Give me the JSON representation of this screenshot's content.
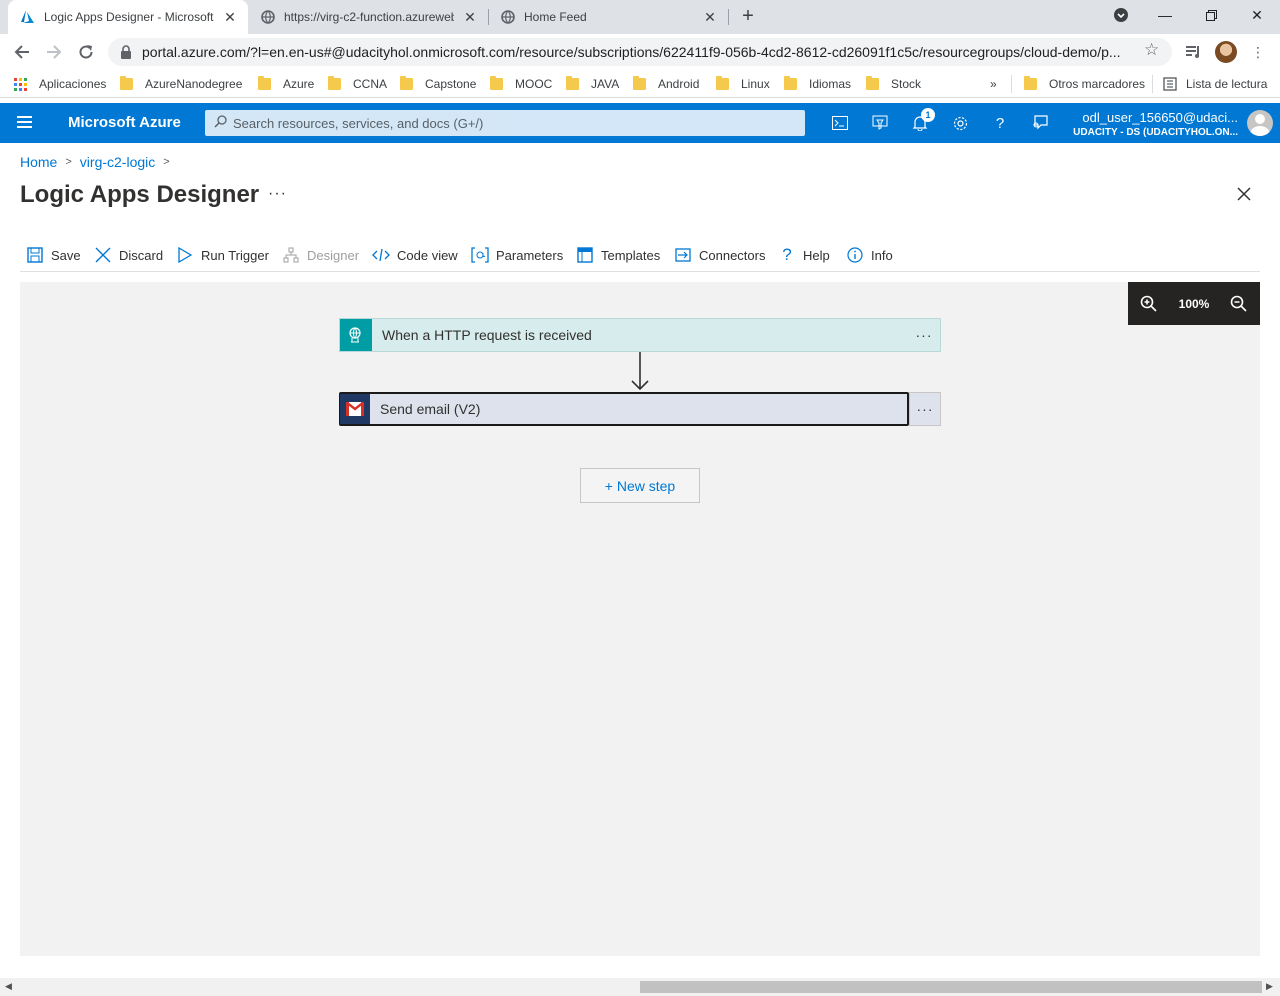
{
  "browser": {
    "tabs": [
      {
        "title": "Logic Apps Designer - Microsoft",
        "active": true
      },
      {
        "title": "https://virg-c2-function.azureweb",
        "active": false
      },
      {
        "title": "Home Feed",
        "active": false
      }
    ],
    "url": "portal.azure.com/?l=en.en-us#@udacityhol.onmicrosoft.com/resource/subscriptions/622411f9-056b-4cd2-8612-cd26091f1c5c/resourcegroups/cloud-demo/p...",
    "bookmarks": [
      "Aplicaciones",
      "AzureNanodegree",
      "Azure",
      "CCNA",
      "Capstone",
      "MOOC",
      "JAVA",
      "Android",
      "Linux",
      "Idiomas",
      "Stock"
    ],
    "bookmarks_overflow": "»",
    "other_bookmarks": "Otros marcadores",
    "reading_list": "Lista de lectura"
  },
  "azure": {
    "brand": "Microsoft Azure",
    "search_placeholder": "Search resources, services, and docs (G+/)",
    "notification_count": "1",
    "user_name": "odl_user_156650@udaci...",
    "user_tenant": "UDACITY - DS (UDACITYHOL.ON..."
  },
  "page": {
    "breadcrumb": [
      "Home",
      "virg-c2-logic"
    ],
    "title": "Logic Apps Designer",
    "more": "···"
  },
  "toolbar": {
    "items": [
      {
        "label": "Save",
        "icon": "save-icon"
      },
      {
        "label": "Discard",
        "icon": "discard-icon"
      },
      {
        "label": "Run Trigger",
        "icon": "run-icon"
      },
      {
        "label": "Designer",
        "icon": "designer-icon",
        "disabled": true
      },
      {
        "label": "Code view",
        "icon": "code-icon"
      },
      {
        "label": "Parameters",
        "icon": "parameters-icon"
      },
      {
        "label": "Templates",
        "icon": "templates-icon"
      },
      {
        "label": "Connectors",
        "icon": "connectors-icon"
      },
      {
        "label": "Help",
        "icon": "help-icon"
      },
      {
        "label": "Info",
        "icon": "info-icon"
      }
    ]
  },
  "designer": {
    "zoom": "100%",
    "steps": [
      {
        "label": "When a HTTP request is received",
        "more": "···"
      },
      {
        "label": "Send email (V2)",
        "more": "···"
      }
    ],
    "new_step": "+ New step"
  },
  "colors": {
    "azure_blue": "#0078d4",
    "trigger_teal": "#009da5",
    "trigger_bg": "#d7ecec",
    "email_bg": "#dde2ed"
  }
}
